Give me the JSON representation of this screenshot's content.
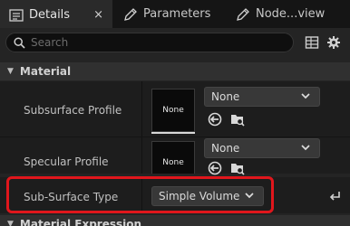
{
  "tabs": [
    {
      "label": "Details",
      "icon": "details-list-icon",
      "active": true,
      "close": "×"
    },
    {
      "label": "Parameters",
      "icon": "pencil-icon",
      "active": false
    },
    {
      "label": "Node...view",
      "icon": "pencil-icon",
      "active": false
    }
  ],
  "search": {
    "placeholder": "Search",
    "icon": "search-icon"
  },
  "toolbar": {
    "icons": [
      "table-view-icon",
      "settings-gear-icon"
    ]
  },
  "sections": [
    {
      "title": "Material",
      "expanded": true,
      "caret": "▼"
    },
    {
      "title": "Material Expression",
      "expanded": true,
      "caret": "▼"
    }
  ],
  "properties": {
    "subsurface_profile": {
      "label": "Subsurface Profile",
      "thumbnail_text": "None",
      "value": "None",
      "icons": [
        "use-selected-asset-icon",
        "browse-asset-icon"
      ]
    },
    "specular_profile": {
      "label": "Specular Profile",
      "thumbnail_text": "None",
      "value": "None",
      "icons": [
        "use-selected-asset-icon",
        "browse-asset-icon"
      ]
    },
    "sub_surface_type": {
      "label": "Sub-Surface Type",
      "value": "Simple Volume",
      "reset_icon": "reset-to-default-icon"
    }
  },
  "colors": {
    "highlight": "#e0161c",
    "panel_bg": "#242424",
    "row_bg": "#1d1d1d",
    "header_bg": "#303030"
  }
}
